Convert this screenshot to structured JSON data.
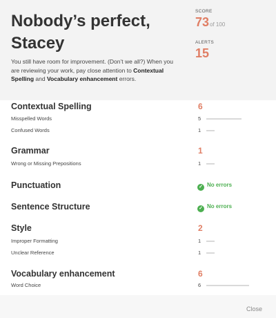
{
  "header": {
    "title_line1": "Nobody’s perfect,",
    "title_line2": "Stacey",
    "intro": {
      "p1": "You still have room for improvement. (Don’t we all?) When you are reviewing your work, pay close attention to ",
      "em1": "Contextual Spelling",
      "p2": " and ",
      "em2": "Vocabulary enhancement",
      "p3": " errors."
    },
    "score_label": "SCORE",
    "score_value": "73",
    "score_of": "of 100",
    "alerts_label": "ALERTS",
    "alerts_value": "15"
  },
  "categories": [
    {
      "name": "Contextual Spelling",
      "count": "6",
      "items": [
        {
          "label": "Misspelled Words",
          "count": "5",
          "level": 0.83
        },
        {
          "label": "Confused Words",
          "count": "1",
          "level": 0.17
        }
      ]
    },
    {
      "name": "Grammar",
      "count": "1",
      "items": [
        {
          "label": "Wrong or Missing Prepositions",
          "count": "1",
          "level": 0.17
        }
      ]
    },
    {
      "name": "Punctuation",
      "status": "No errors"
    },
    {
      "name": "Sentence Structure",
      "status": "No errors"
    },
    {
      "name": "Style",
      "count": "2",
      "items": [
        {
          "label": "Improper Formatting",
          "count": "1",
          "level": 0.17
        },
        {
          "label": "Unclear Reference",
          "count": "1",
          "level": 0.17
        }
      ]
    },
    {
      "name": "Vocabulary enhancement",
      "count": "6",
      "items": [
        {
          "label": "Word Choice",
          "count": "6",
          "level": 1.0
        }
      ]
    }
  ],
  "close_label": "Close",
  "colors": {
    "accent": "#e07e64",
    "success": "#4caf50",
    "bar": "#d9d9d9"
  },
  "icons": {
    "no_errors": "check-circle-icon"
  }
}
